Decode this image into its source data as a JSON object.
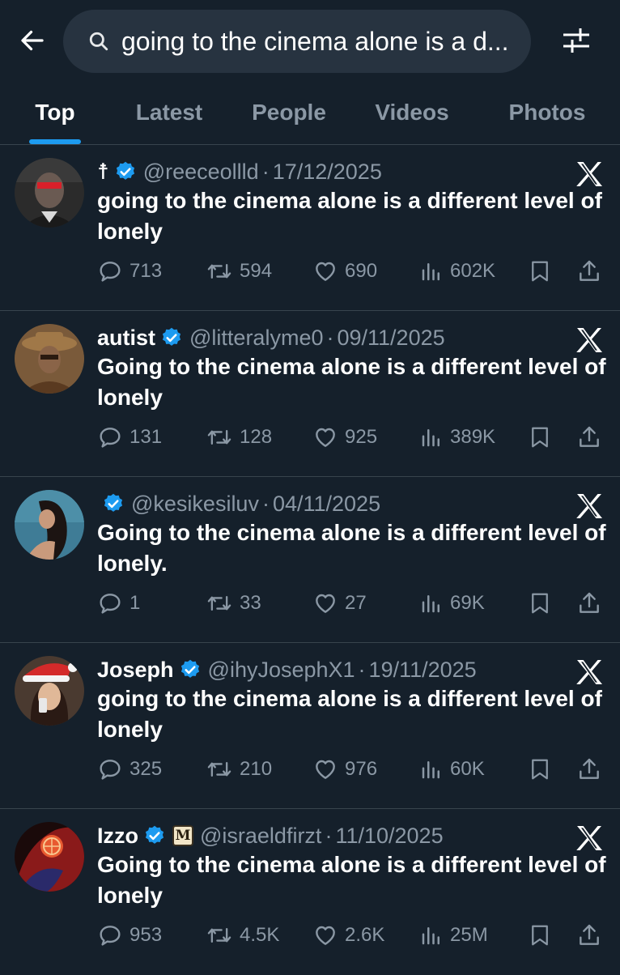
{
  "search": {
    "value": "going to the cinema alone is a d...",
    "placeholder": "Search"
  },
  "tabs": [
    {
      "label": "Top",
      "active": true
    },
    {
      "label": "Latest",
      "active": false
    },
    {
      "label": "People",
      "active": false
    },
    {
      "label": "Videos",
      "active": false
    },
    {
      "label": "Photos",
      "active": false
    }
  ],
  "tweets": [
    {
      "name": "☨",
      "verified": true,
      "handle": "@reeceollld",
      "date": "17/12/2025",
      "text": "going to the cinema alone is a different level of lonely",
      "replies": "713",
      "retweets": "594",
      "likes": "690",
      "views": "602K"
    },
    {
      "name": "autist",
      "verified": true,
      "handle": "@litteralyme0",
      "date": "09/11/2025",
      "text": "Going to the cinema alone is a different level of lonely",
      "replies": "131",
      "retweets": "128",
      "likes": "925",
      "views": "389K"
    },
    {
      "name": "",
      "verified": true,
      "handle": "@kesikesiluv",
      "date": "04/11/2025",
      "text": "Going to the cinema alone is a different level of lonely.",
      "replies": "1",
      "retweets": "33",
      "likes": "27",
      "views": "69K"
    },
    {
      "name": "Joseph",
      "verified": true,
      "handle": "@ihyJosephX1",
      "date": "19/11/2025",
      "text": "going to the cinema alone is a different level of lonely",
      "replies": "325",
      "retweets": "210",
      "likes": "976",
      "views": "60K"
    },
    {
      "name": "Izzo",
      "verified": true,
      "affiliate_badge": "M",
      "handle": "@israeldfirzt",
      "date": "11/10/2025",
      "text": "Going to the cinema alone is a different level of lonely",
      "replies": "953",
      "retweets": "4.5K",
      "likes": "2.6K",
      "views": "25M"
    }
  ],
  "colors": {
    "background": "#15202b",
    "accent": "#1d9bf0",
    "muted": "#8b98a5",
    "divider": "#38444d"
  },
  "icons": [
    "back-arrow-icon",
    "search-icon",
    "filter-icon",
    "verified-badge-icon",
    "x-logo-icon",
    "reply-icon",
    "retweet-icon",
    "like-icon",
    "views-icon",
    "bookmark-icon",
    "share-icon"
  ]
}
